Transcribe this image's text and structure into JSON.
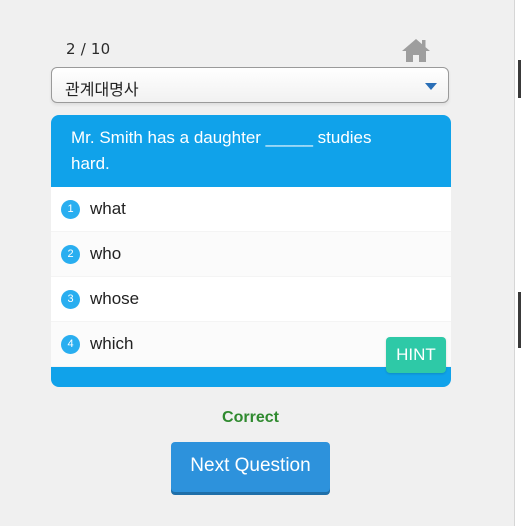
{
  "progress": {
    "current": 2,
    "total": 10,
    "label": "2 / 10"
  },
  "home_icon": "home-icon",
  "category_select": {
    "selected": "관계대명사"
  },
  "question": {
    "text": "Mr. Smith has a daughter _____ studies hard."
  },
  "options": [
    {
      "number": "1",
      "text": "what"
    },
    {
      "number": "2",
      "text": "who"
    },
    {
      "number": "3",
      "text": "whose"
    },
    {
      "number": "4",
      "text": "which"
    }
  ],
  "hint_label": "HINT",
  "result_text": "Correct",
  "next_label": "Next Question",
  "colors": {
    "card": "#10a2ea",
    "number_badge": "#29aef0",
    "hint": "#2ec9a7",
    "correct": "#2f8a2f",
    "next_button": "#2d92dc"
  }
}
